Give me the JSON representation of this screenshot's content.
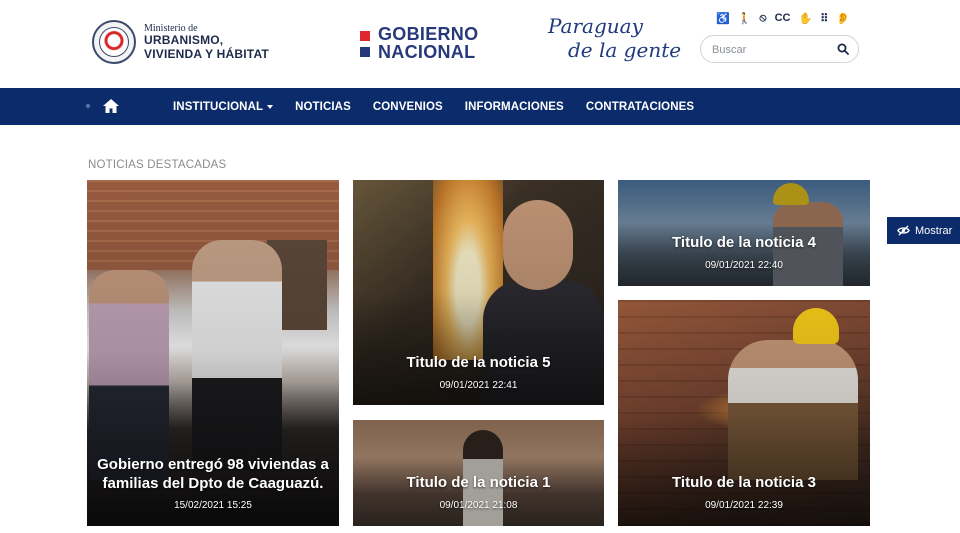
{
  "ministry": {
    "line1": "Ministerio de",
    "line2": "URBANISMO,",
    "line3": "VIVIENDA Y HÁBITAT"
  },
  "gobierno": {
    "line1": "GOBIERNO",
    "line2": "NACIONAL",
    "colors": {
      "red": "#e0262f",
      "blue": "#27397a"
    }
  },
  "slogan": {
    "line1": "Paraguay",
    "line2": "de la gente"
  },
  "accessibility_icons": [
    "wheelchair-icon",
    "walking-icon",
    "hide-icon",
    "cc-icon",
    "sign-language-icon",
    "braille-icon",
    "ear-icon"
  ],
  "accessibility_glyphs": [
    "♿",
    "🚶",
    "⦸",
    "CC",
    "✋",
    "⠿",
    "👂"
  ],
  "search": {
    "placeholder": "Buscar",
    "value": ""
  },
  "nav": {
    "items": [
      {
        "label": "INSTITUCIONAL",
        "dropdown": true
      },
      {
        "label": "NOTICIAS"
      },
      {
        "label": "CONVENIOS"
      },
      {
        "label": "INFORMACIONES"
      },
      {
        "label": "CONTRATACIONES"
      }
    ],
    "bg_color": "#0b2b6b"
  },
  "section": {
    "title": "NOTICIAS DESTACADAS"
  },
  "news": {
    "main": {
      "title": "Gobierno entregó 98 viviendas a familias del Dpto de Caaguazú.",
      "date": "15/02/2021 15:25"
    },
    "n5": {
      "title": "Titulo de la noticia 5",
      "date": "09/01/2021 22:41"
    },
    "n4": {
      "title": "Titulo de la noticia 4",
      "date": "09/01/2021 22:40"
    },
    "n1": {
      "title": "Titulo de la noticia 1",
      "date": "09/01/2021 21:08"
    },
    "n3": {
      "title": "Titulo de la noticia 3",
      "date": "09/01/2021 22:39"
    }
  },
  "mostrar": {
    "label": "Mostrar"
  }
}
